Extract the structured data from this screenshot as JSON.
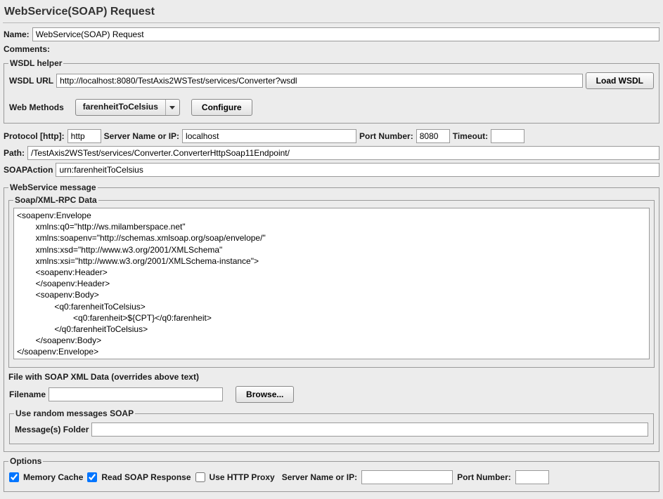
{
  "title": "WebService(SOAP) Request",
  "name": {
    "label": "Name:",
    "value": "WebService(SOAP) Request"
  },
  "comments": {
    "label": "Comments:"
  },
  "wsdl": {
    "legend": "WSDL helper",
    "url_label": "WSDL URL",
    "url_value": "http://localhost:8080/TestAxis2WSTest/services/Converter?wsdl",
    "load_btn": "Load WSDL",
    "methods_label": "Web Methods",
    "methods_selected": "farenheitToCelsius",
    "configure_btn": "Configure"
  },
  "conn": {
    "protocol_label": "Protocol [http]:",
    "protocol_value": "http",
    "server_label": "Server Name or IP:",
    "server_value": "localhost",
    "port_label": "Port Number:",
    "port_value": "8080",
    "timeout_label": "Timeout:",
    "timeout_value": "",
    "path_label": "Path:",
    "path_value": "/TestAxis2WSTest/services/Converter.ConverterHttpSoap11Endpoint/",
    "soapaction_label": "SOAPAction",
    "soapaction_value": "urn:farenheitToCelsius"
  },
  "msg": {
    "legend": "WebService message",
    "data_legend": "Soap/XML-RPC Data",
    "soap_body": "<soapenv:Envelope\n        xmlns:q0=\"http://ws.milamberspace.net\"\n        xmlns:soapenv=\"http://schemas.xmlsoap.org/soap/envelope/\"\n        xmlns:xsd=\"http://www.w3.org/2001/XMLSchema\"\n        xmlns:xsi=\"http://www.w3.org/2001/XMLSchema-instance\">\n        <soapenv:Header>\n        </soapenv:Header>\n        <soapenv:Body>\n                <q0:farenheitToCelsius>\n                        <q0:farenheit>${CPT}</q0:farenheit>\n                </q0:farenheitToCelsius>\n        </soapenv:Body>\n</soapenv:Envelope>",
    "file_header": "File with SOAP XML Data (overrides above text)",
    "filename_label": "Filename",
    "filename_value": "",
    "browse_btn": "Browse...",
    "random_legend": "Use random messages SOAP",
    "random_label": "Message(s) Folder",
    "random_value": ""
  },
  "opts": {
    "legend": "Options",
    "memcache_label": "Memory Cache",
    "memcache_checked": true,
    "readresp_label": "Read SOAP Response",
    "readresp_checked": true,
    "proxy_label": "Use HTTP Proxy",
    "proxy_checked": false,
    "proxy_server_label": "Server Name or IP:",
    "proxy_server_value": "",
    "proxy_port_label": "Port Number:",
    "proxy_port_value": ""
  }
}
